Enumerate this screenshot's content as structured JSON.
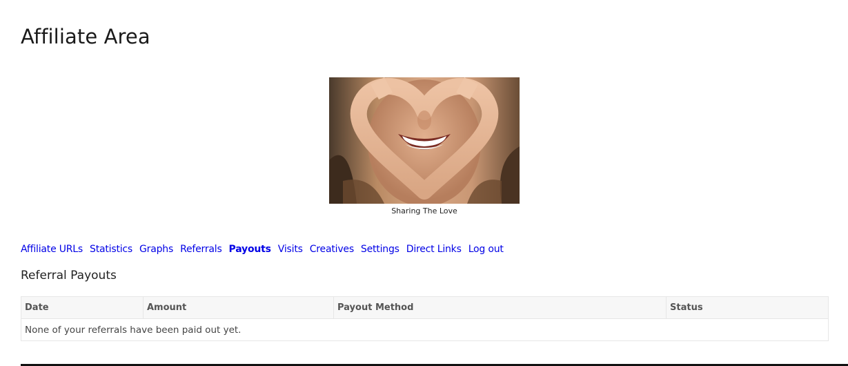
{
  "page": {
    "title": "Affiliate Area"
  },
  "featured_image": {
    "caption": "Sharing The Love",
    "icon": "heart-hands-smile-photo"
  },
  "tabs": {
    "active": "Payouts",
    "items": [
      {
        "label": "Affiliate URLs"
      },
      {
        "label": "Statistics"
      },
      {
        "label": "Graphs"
      },
      {
        "label": "Referrals"
      },
      {
        "label": "Payouts"
      },
      {
        "label": "Visits"
      },
      {
        "label": "Creatives"
      },
      {
        "label": "Settings"
      },
      {
        "label": "Direct Links"
      },
      {
        "label": "Log out"
      }
    ]
  },
  "payouts": {
    "heading": "Referral Payouts",
    "columns": [
      "Date",
      "Amount",
      "Payout Method",
      "Status"
    ],
    "empty_message": "None of your referrals have been paid out yet."
  },
  "colors": {
    "link": "#0000e6",
    "text": "#333333",
    "table_header_bg": "#f7f7f7",
    "table_border": "#e6e6e6"
  }
}
